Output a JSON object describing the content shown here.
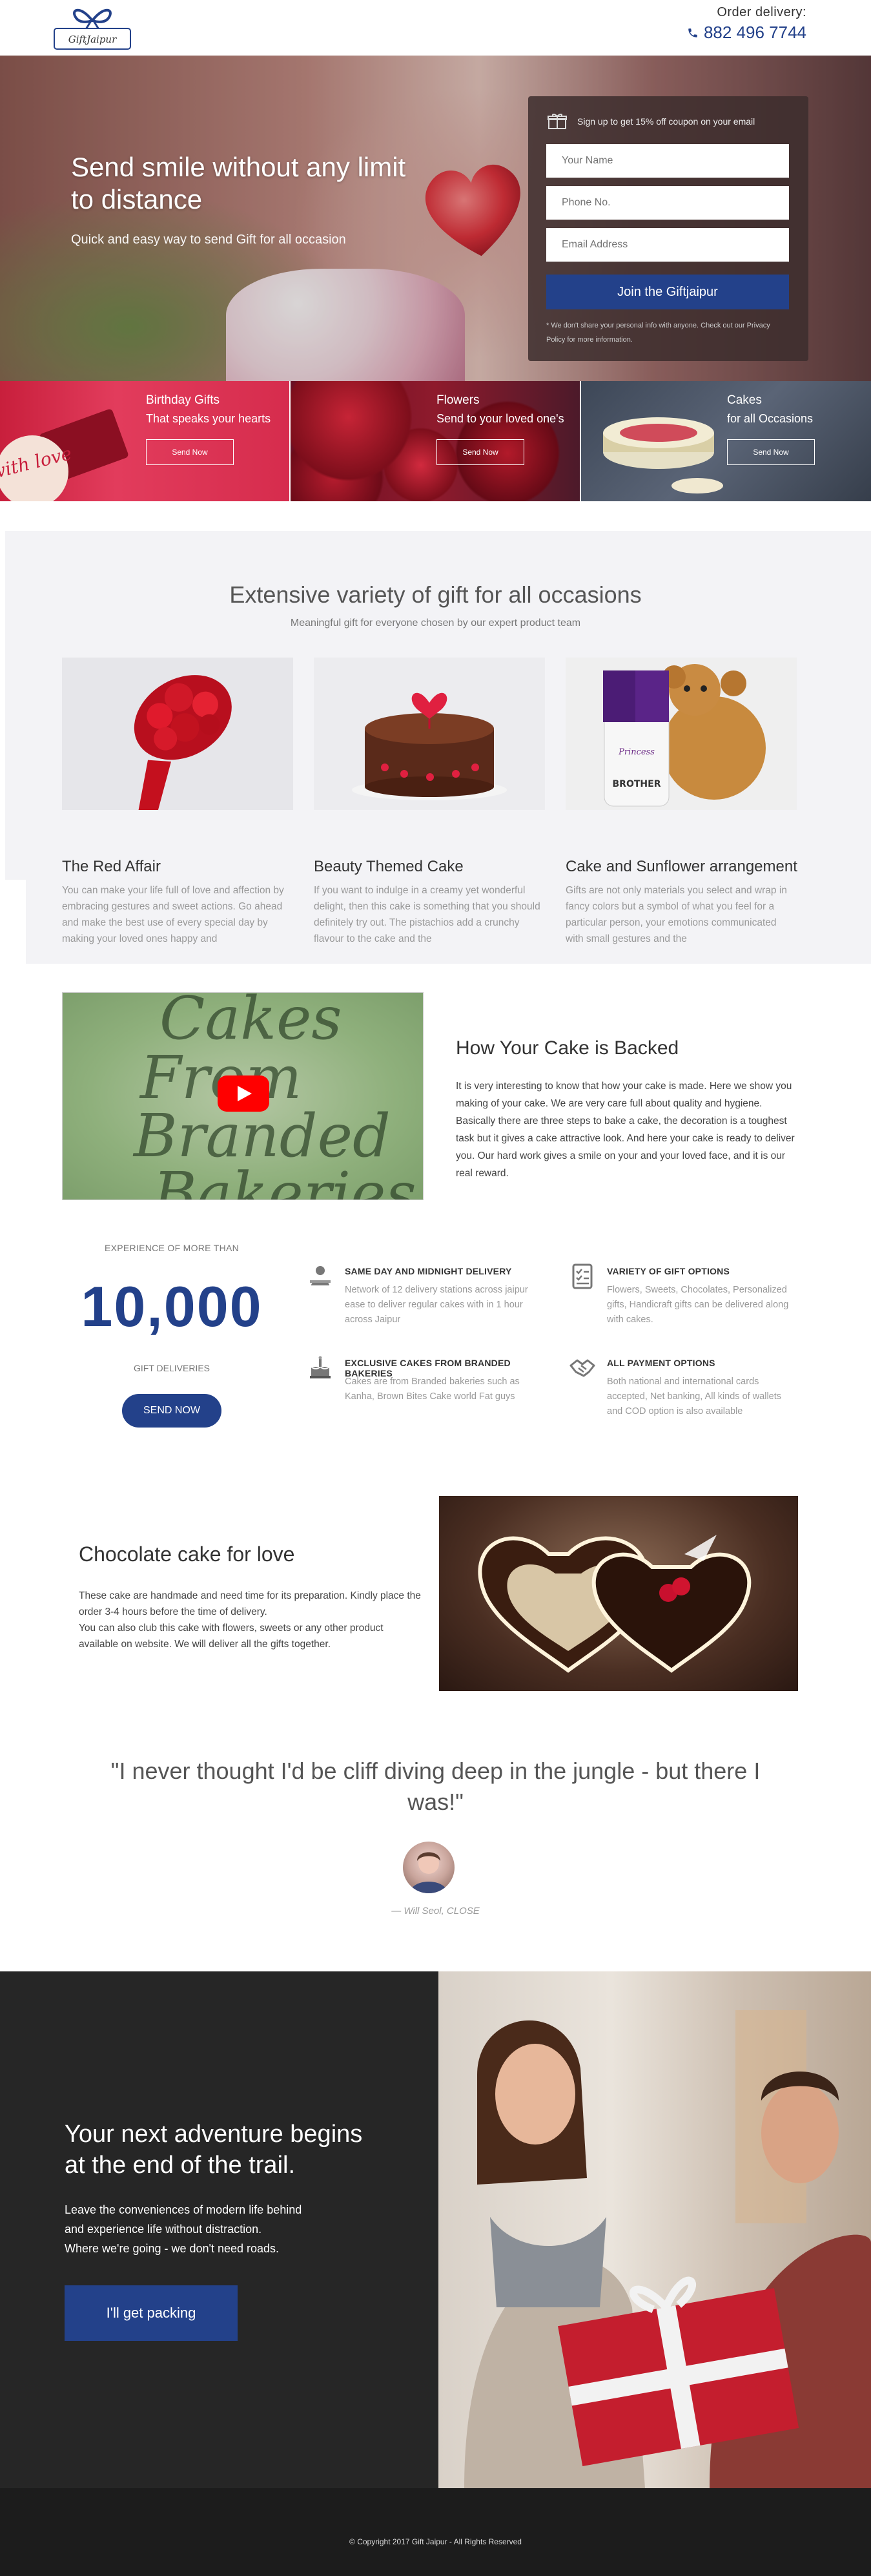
{
  "header": {
    "logo_text": "GiftJaipur",
    "order_label": "Order delivery:",
    "phone": "882 496 7744"
  },
  "hero": {
    "headline": "Send smile without any limit to distance",
    "subtitle": "Quick and easy way to send Gift for all occasion",
    "form": {
      "heading": "Sign up to get 15% off coupon on your email",
      "name_placeholder": "Your Name",
      "phone_placeholder": "Phone No.",
      "email_placeholder": "Email Address",
      "submit_label": "Join the Giftjaipur",
      "note": "* We don't share your personal info with anyone. Check out our Privacy Policy for more information."
    }
  },
  "categories": [
    {
      "title": "Birthday Gifts",
      "subtitle": "That speaks your hearts",
      "button": "Send Now",
      "badge": "with love"
    },
    {
      "title": "Flowers",
      "subtitle": "Send to your loved one's",
      "button": "Send Now"
    },
    {
      "title": "Cakes",
      "subtitle": "for all Occasions",
      "button": "Send Now"
    }
  ],
  "variety": {
    "title": "Extensive variety of gift for all occasions",
    "subtitle": "Meaningful gift for everyone chosen by our expert product team",
    "products": [
      {
        "name": "The Red Affair",
        "desc": "You can make your life full of love and affection by embracing gestures and sweet actions. Go ahead and make the best use of every special day by making your loved ones happy and"
      },
      {
        "name": "Beauty Themed Cake",
        "desc": "If you want to indulge in a creamy yet wonderful delight, then this cake is something that you should definitely try out. The pistachios add a crunchy flavour to the cake and the"
      },
      {
        "name": "Cake and Sunflower arrangement",
        "desc": "Gifts are not only materials you select and wrap in fancy colors but a symbol of what you feel for a particular person, your emotions communicated with small gestures and the"
      }
    ],
    "gift_mug_text": "Princess Guarded by a Big BROTHER"
  },
  "video": {
    "overlay_lines": [
      "Cakes",
      "From",
      "Branded",
      "Bakeries"
    ],
    "title": "How Your Cake is Backed",
    "text": "It is very interesting to know that how your cake is made. Here we show you making of your cake. We are very care full about quality and hygiene. Basically there are three steps to bake a cake, the decoration is a toughest task but it gives a cake attractive look. And here your cake is ready to deliver you. Our hard work gives a smile on your and your loved face, and it is our real reward."
  },
  "stats": {
    "experience_label": "EXPERIENCE OF MORE THAN",
    "number": "10,000",
    "deliveries_label": "GIFT DELIVERIES",
    "button": "SEND NOW",
    "features": [
      {
        "title": "SAME DAY AND MIDNIGHT DELIVERY",
        "desc": "Network of 12 delivery stations across jaipur ease to deliver regular cakes with in 1 hour across Jaipur",
        "icon": "delivery-person-icon"
      },
      {
        "title": "VARIETY OF GIFT OPTIONS",
        "desc": "Flowers, Sweets, Chocolates, Personalized gifts, Handicraft gifts can be delivered along with cakes.",
        "icon": "checklist-icon"
      },
      {
        "title": "EXCLUSIVE CAKES FROM BRANDED BAKERIES",
        "desc": "Cakes are from Branded bakeries such as Kanha, Brown Bites Cake world Fat guys",
        "icon": "cake-icon"
      },
      {
        "title": "ALL PAYMENT OPTIONS",
        "desc": "Both national and international cards accepted, Net banking, All kinds of wallets and COD option is also available",
        "icon": "handshake-icon"
      }
    ]
  },
  "chocolate": {
    "title": "Chocolate cake for love",
    "text1": "These cake are handmade and need time for its preparation. Kindly place the order 3-4 hours before the time of delivery.",
    "text2": "You can also club this cake with flowers, sweets or any other product available on website. We will deliver all the gifts together."
  },
  "testimonial": {
    "quote": "\"I never thought I'd be cliff diving deep in the jungle - but there I was!\"",
    "author": "— Will Seol, CLOSE"
  },
  "adventure": {
    "title": "Your next adventure begins at the end of the trail.",
    "line1": "Leave the conveniences of modern life behind",
    "line2": "and experience life without distraction.",
    "line3": "Where we're going - we don't need roads.",
    "button": "I'll get packing"
  },
  "footer": {
    "copyright": "© Copyright 2017 Gift Jaipur - All Rights Reserved"
  },
  "colors": {
    "brand_blue": "#23418a",
    "dark_section": "#262626",
    "footer_bg": "#1c1c1c",
    "variety_bg": "#f3f3f6"
  }
}
